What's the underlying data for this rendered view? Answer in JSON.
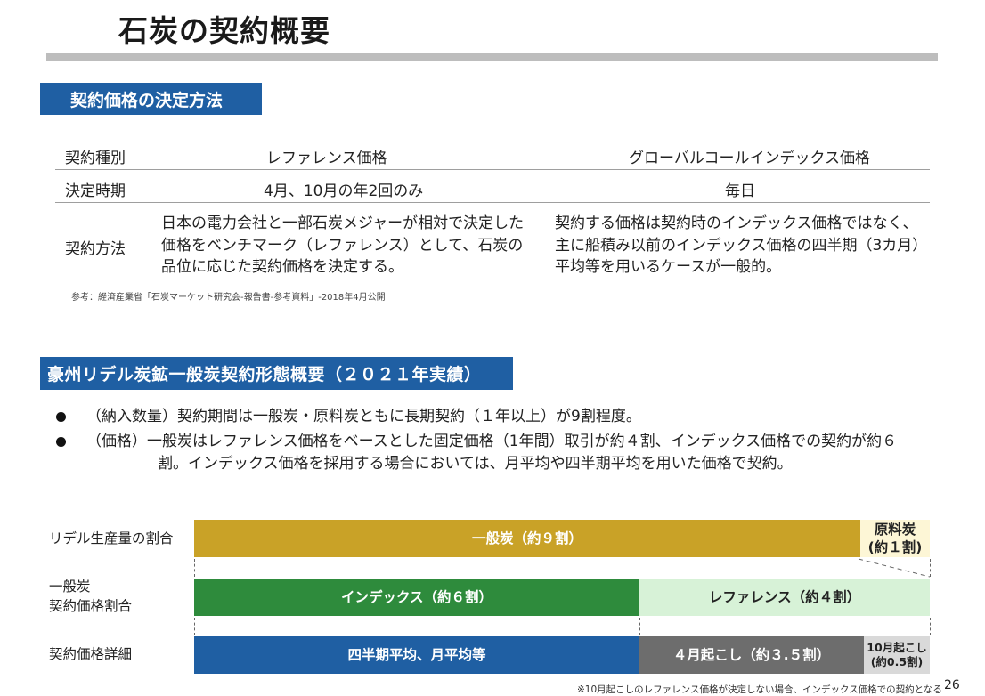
{
  "header": {
    "title": "石炭の契約概要",
    "page_number": "26"
  },
  "section1": {
    "heading": "契約価格の決定方法",
    "columns": [
      "契約種別",
      "レファレンス価格",
      "グローバルコールインデックス価格"
    ],
    "rows": [
      {
        "label": "決定時期",
        "reference": "4月、10月の年2回のみ",
        "index": "毎日"
      },
      {
        "label": "契約方法",
        "reference": "日本の電力会社と一部石炭メジャーが相対で決定した価格をベンチマーク（レファレンス）として、石炭の品位に応じた契約価格を決定する。",
        "index": "契約する価格は契約時のインデックス価格ではなく、主に船積み以前のインデックス価格の四半期（3カ月）平均等を用いるケースが一般的。"
      }
    ],
    "note": "参考：経済産業省「石炭マーケット研究会-報告書-参考資料」-2018年4月公開"
  },
  "section2": {
    "heading": "豪州リデル炭鉱一般炭契約形態概要（２０２１年実績）",
    "bullets": [
      "（納入数量）契約期間は一般炭・原料炭ともに長期契約（１年以上）が9割程度。",
      "（価格）一般炭はレファレンス価格をベースとした固定価格（1年間）取引が約４割、インデックス価格での契約が約６割。インデックス価格を採用する場合においては、月平均や四半期平均を用いた価格で契約。"
    ]
  },
  "chart": {
    "rows": [
      {
        "label": "リデル生産量の割合",
        "segments": [
          {
            "label": "一般炭（約９割）",
            "share": 0.9,
            "color": "#c9a227"
          },
          {
            "label": "原料炭\n(約１割)",
            "share": 0.1,
            "color": "#fdf6d6"
          }
        ]
      },
      {
        "label": "一般炭\n契約価格割合",
        "segments": [
          {
            "label": "インデックス（約６割）",
            "share": 0.6,
            "color": "#2e8b3c"
          },
          {
            "label": "レファレンス（約４割）",
            "share": 0.4,
            "color": "#d7f2d7"
          }
        ]
      },
      {
        "label": "契約価格詳細",
        "segments": [
          {
            "label": "四半期平均、月平均等",
            "share": 0.6,
            "color": "#1f5fa3"
          },
          {
            "label": "４月起こし（約３.５割）",
            "share": 0.35,
            "color": "#6d6d6d"
          },
          {
            "label": "10月起こし\n(約0.5割)",
            "share": 0.05,
            "color": "#d9d9d9"
          }
        ]
      }
    ],
    "footnote": "※10月起こしのレファレンス価格が決定しない場合、インデックス価格での契約となる"
  }
}
